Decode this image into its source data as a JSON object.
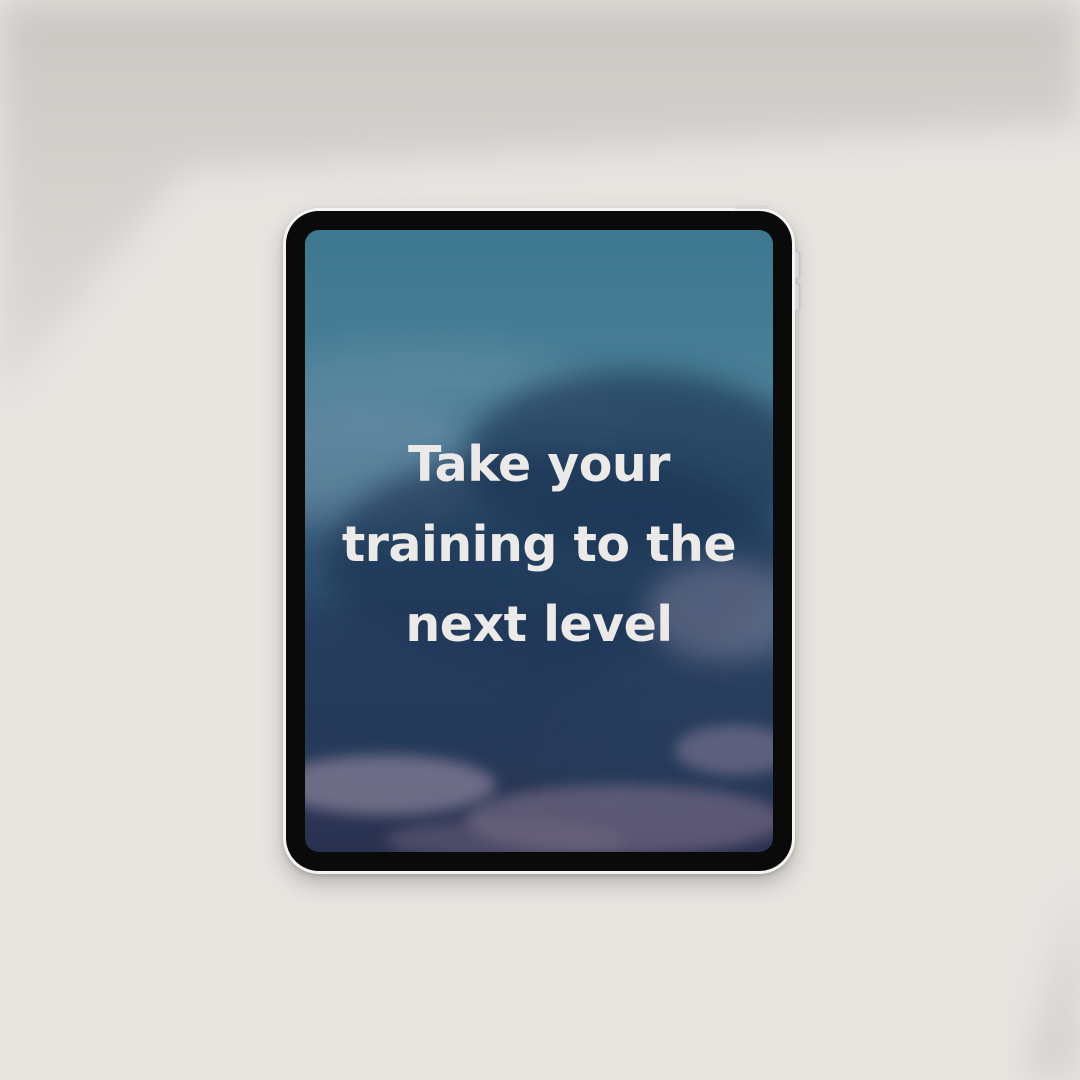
{
  "headline": {
    "lines": [
      "Take your",
      "training to the",
      "next level"
    ]
  },
  "colors": {
    "background": "#e8e5e1",
    "bezel": "#0a0a0b",
    "frame": "#f4f4f3",
    "text": "#eceae8",
    "sky_top": "#3f7a93",
    "sky_mid": "#2e4e6a",
    "sky_bottom": "#2a3450",
    "cloud_pink": "#8c7f96"
  }
}
